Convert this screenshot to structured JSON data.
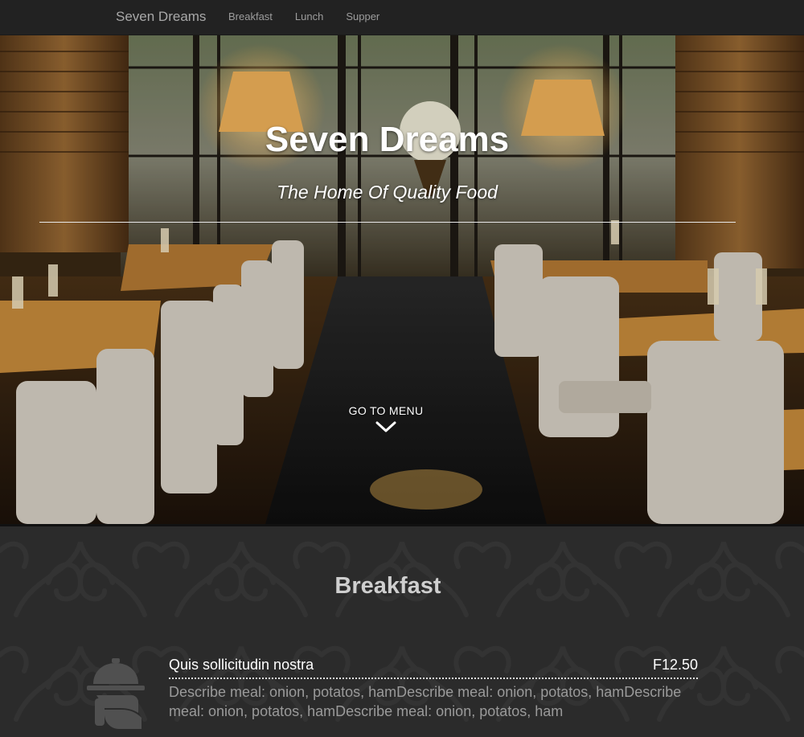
{
  "nav": {
    "brand": "Seven Dreams",
    "links": [
      "Breakfast",
      "Lunch",
      "Supper"
    ]
  },
  "hero": {
    "title": "Seven Dreams",
    "subtitle": "The Home Of Quality Food",
    "cta_label": "GO TO MENU",
    "cta_icon": "chevron-down-icon"
  },
  "menu": {
    "section_title": "Breakfast",
    "items": [
      {
        "name": "Quis sollicitudin nostra",
        "price": "F12.50",
        "description": "Describe meal: onion, potatos, hamDescribe meal: onion, potatos, hamDescribe meal: onion, potatos, hamDescribe meal: onion, potatos, ham",
        "icon": "food-cloche-icon"
      }
    ]
  },
  "colors": {
    "navbar_bg": "#222222",
    "menu_bg": "#2b2b2b",
    "title_text": "#cfcfcf",
    "desc_text": "#9a9a9a"
  }
}
